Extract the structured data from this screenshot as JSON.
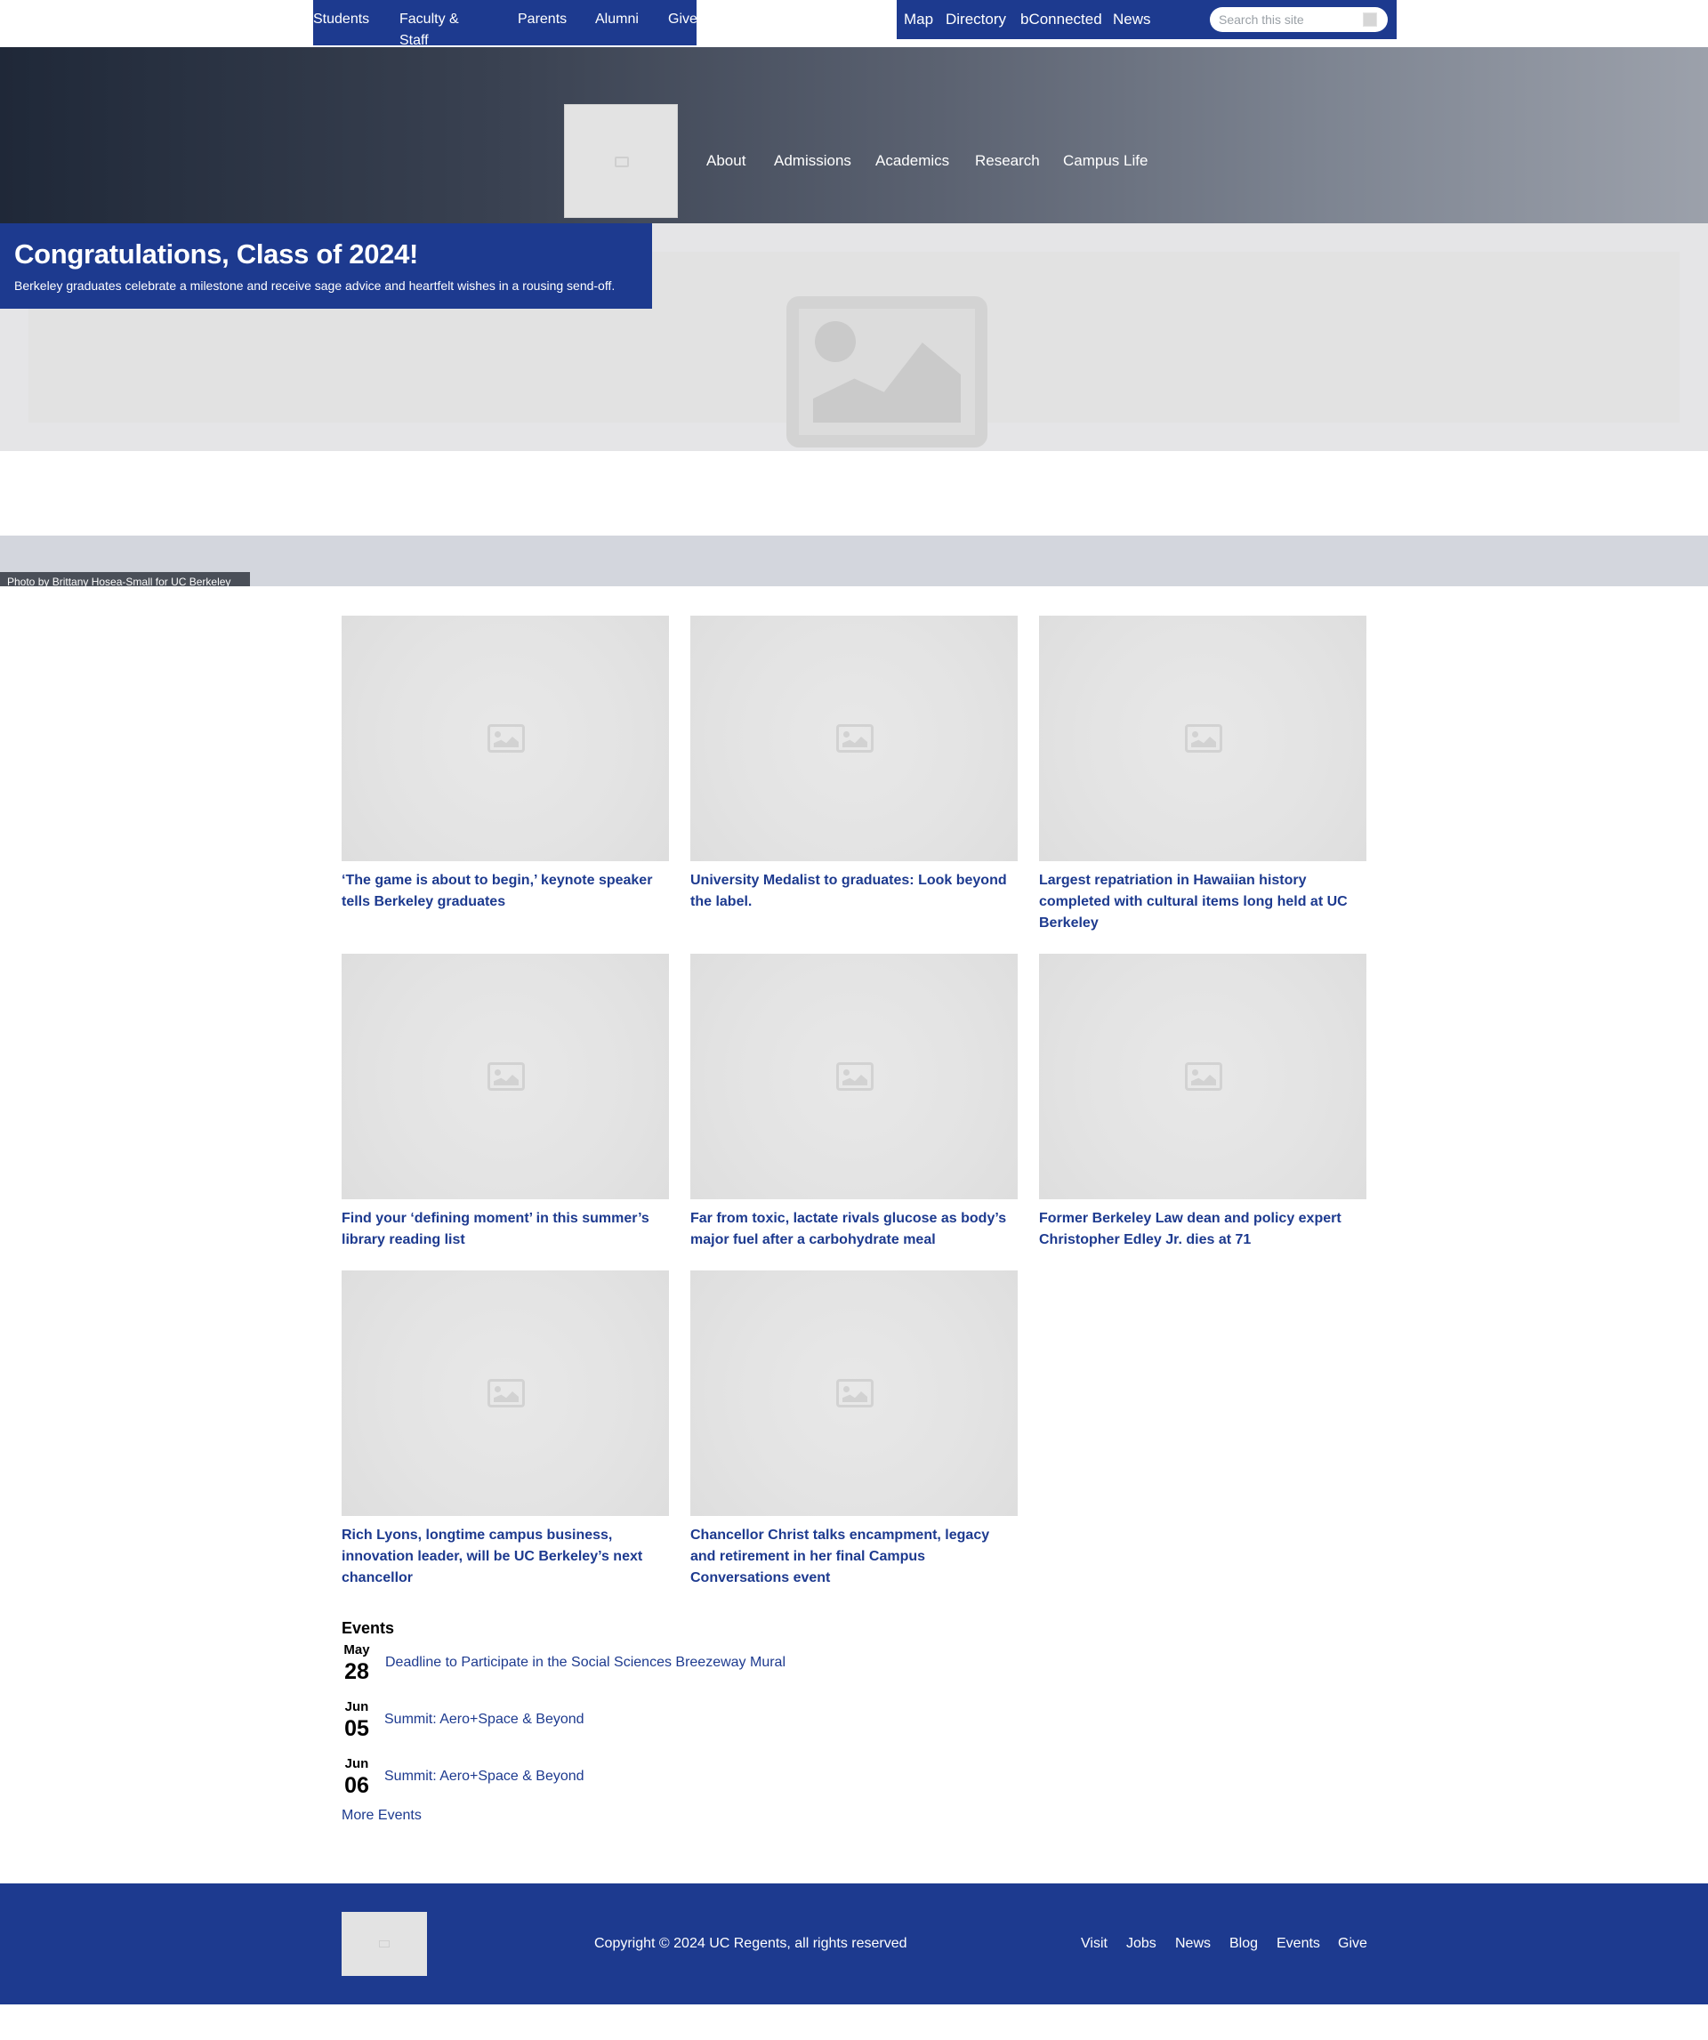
{
  "audience_nav": [
    "Students",
    "Faculty & Staff",
    "Parents",
    "Alumni",
    "Give"
  ],
  "utility_nav": [
    "Map",
    "Directory",
    "bConnected",
    "News"
  ],
  "search": {
    "placeholder": "Search this site"
  },
  "main_nav": [
    "About",
    "Admissions",
    "Academics",
    "Research",
    "Campus Life"
  ],
  "hero": {
    "title": "Congratulations, Class of 2024!",
    "subtitle": "Berkeley graduates celebrate a milestone and receive sage advice and heartfelt wishes in a rousing send-off.",
    "credit": "Photo by Brittany Hosea-Small for UC Berkeley"
  },
  "news": [
    "‘The game is about to begin,’ keynote speaker tells Berkeley graduates",
    "University Medalist to graduates: Look beyond the label.",
    "Largest repatriation in Hawaiian history completed with cultural items long held at UC Berkeley",
    "Find your ‘defining moment’ in this summer’s library reading list",
    "Far from toxic, lactate rivals glucose as body’s major fuel after a carbohydrate meal",
    "Former Berkeley Law dean and policy expert Christopher Edley Jr. dies at 71",
    "Rich Lyons, longtime campus business, innovation leader, will be UC Berkeley’s next chancellor",
    "Chancellor Christ talks encampment, legacy and retirement in her final Campus Conversations event"
  ],
  "events": {
    "heading": "Events",
    "items": [
      {
        "month": "May",
        "day": "28",
        "title": "Deadline to Participate in the Social Sciences Breezeway Mural"
      },
      {
        "month": "Jun",
        "day": "05",
        "title": "Summit: Aero+Space & Beyond"
      },
      {
        "month": "Jun",
        "day": "06",
        "title": "Summit: Aero+Space & Beyond"
      }
    ],
    "more": "More Events"
  },
  "footer": {
    "copyright": "Copyright © 2024 UC Regents, all rights reserved",
    "links": [
      "Visit",
      "Jobs",
      "News",
      "Blog",
      "Events",
      "Give"
    ]
  },
  "colors": {
    "primary": "#1d3a8f",
    "band": "#d3d6dd"
  }
}
